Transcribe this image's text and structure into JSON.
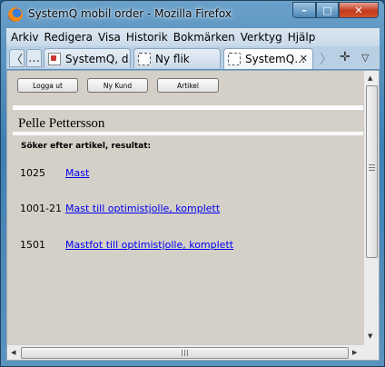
{
  "window": {
    "title": "SystemQ mobil order - Mozilla Firefox",
    "controls": {
      "minimize": "–",
      "maximize": "□",
      "close": "✕"
    }
  },
  "menubar": {
    "items": [
      "Arkiv",
      "Redigera",
      "Visa",
      "Historik",
      "Bokmärken",
      "Verktyg",
      "Hjälp"
    ]
  },
  "tabbar": {
    "back_glyph": "〈",
    "ellipsis": "…",
    "tabs": [
      {
        "label": "SystemQ, d…",
        "icon": "app-favicon-icon"
      },
      {
        "label": "Ny flik",
        "icon": "blank-page-icon"
      },
      {
        "label": "SystemQ…",
        "icon": "blank-page-icon",
        "active": true
      }
    ],
    "close_glyph": "✕",
    "scroll_right_glyph": "〉",
    "new_tab_glyph": "✛",
    "list_tabs_glyph": "▽"
  },
  "page": {
    "buttons": [
      "Logga ut",
      "Ny Kund",
      "Artikel"
    ],
    "customer_name": "Pelle Pettersson",
    "search_heading": "Söker efter artikel, resultat:",
    "results": [
      {
        "code": "1025",
        "name": "Mast"
      },
      {
        "code": "1001-21",
        "name": "Mast till optimistjolle, komplett"
      },
      {
        "code": "1501",
        "name": "Mastfot till optimistjolle, komplett"
      }
    ]
  },
  "scrollbars": {
    "up_glyph": "▲",
    "down_glyph": "▼",
    "left_glyph": "◀",
    "right_glyph": "▶"
  }
}
